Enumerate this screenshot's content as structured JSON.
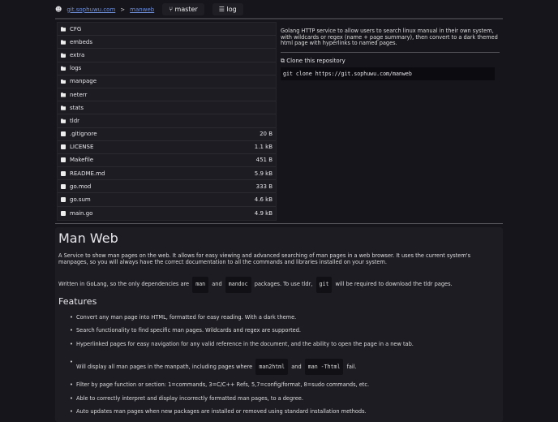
{
  "header": {
    "host": "git.sophuwu.com",
    "sep": ">",
    "repo": "manweb",
    "branch": "master",
    "log": "log"
  },
  "files": [
    {
      "name": "CFG",
      "type": "dir",
      "size": ""
    },
    {
      "name": "embeds",
      "type": "dir",
      "size": ""
    },
    {
      "name": "extra",
      "type": "dir",
      "size": ""
    },
    {
      "name": "logs",
      "type": "dir",
      "size": ""
    },
    {
      "name": "manpage",
      "type": "dir",
      "size": ""
    },
    {
      "name": "neterr",
      "type": "dir",
      "size": ""
    },
    {
      "name": "stats",
      "type": "dir",
      "size": ""
    },
    {
      "name": "tldr",
      "type": "dir",
      "size": ""
    },
    {
      "name": ".gitignore",
      "type": "file",
      "size": "20 B"
    },
    {
      "name": "LICENSE",
      "type": "file",
      "size": "1.1 kB"
    },
    {
      "name": "Makefile",
      "type": "file",
      "size": "451 B"
    },
    {
      "name": "README.md",
      "type": "file",
      "size": "5.9 kB"
    },
    {
      "name": "go.mod",
      "type": "file",
      "size": "333 B"
    },
    {
      "name": "go.sum",
      "type": "file",
      "size": "4.6 kB"
    },
    {
      "name": "main.go",
      "type": "file",
      "size": "4.9 kB"
    }
  ],
  "side": {
    "description": "Golang HTTP service to allow users to search linux manual in their own system, with wildcards or regex (name + page summary), then convert to a dark themed html page with hyperlinks to named pages.",
    "clone_label": "Clone this repository",
    "clone_cmd": "git clone https://git.sophuwu.com/manweb"
  },
  "readme": {
    "title": "Man Web",
    "intro": "A Service to show man pages on the web. It allows for easy viewing and advanced searching of man pages in a web browser. It uses the current system's manpages, so you will always have the correct documentation to all the commands and libraries installed on your system.",
    "dep1": "Written in GoLang, so the only dependencies are",
    "code1": "man",
    "and1": "and",
    "code2": "mandoc",
    "dep2": "packages. To use tldr,",
    "code3": "git",
    "dep3": "will be required to download the tldr pages.",
    "features_title": "Features",
    "f1": "Convert any man page into HTML, formatted for easy reading. With a dark theme.",
    "f2": "Search functionality to find specific man pages. Wildcards and regex are supported.",
    "f3": "Hyperlinked pages for easy navigation for any valid reference in the document, and the ability to open the page in a new tab.",
    "f4a": "Will display all man pages in the manpath, including pages where",
    "f4c1": "man2html",
    "f4and": "and",
    "f4c2": "man -Thtml",
    "f4b": "fail.",
    "f5": "Filter by page function or section: 1=commands, 3=C/C++ Refs, 5,7=config/format, 8=sudo commands, etc.",
    "f6": "Able to correctly interpret and display incorrectly formatted man pages, to a degree.",
    "f7": "Auto updates man pages when new packages are installed or removed using standard installation methods."
  }
}
